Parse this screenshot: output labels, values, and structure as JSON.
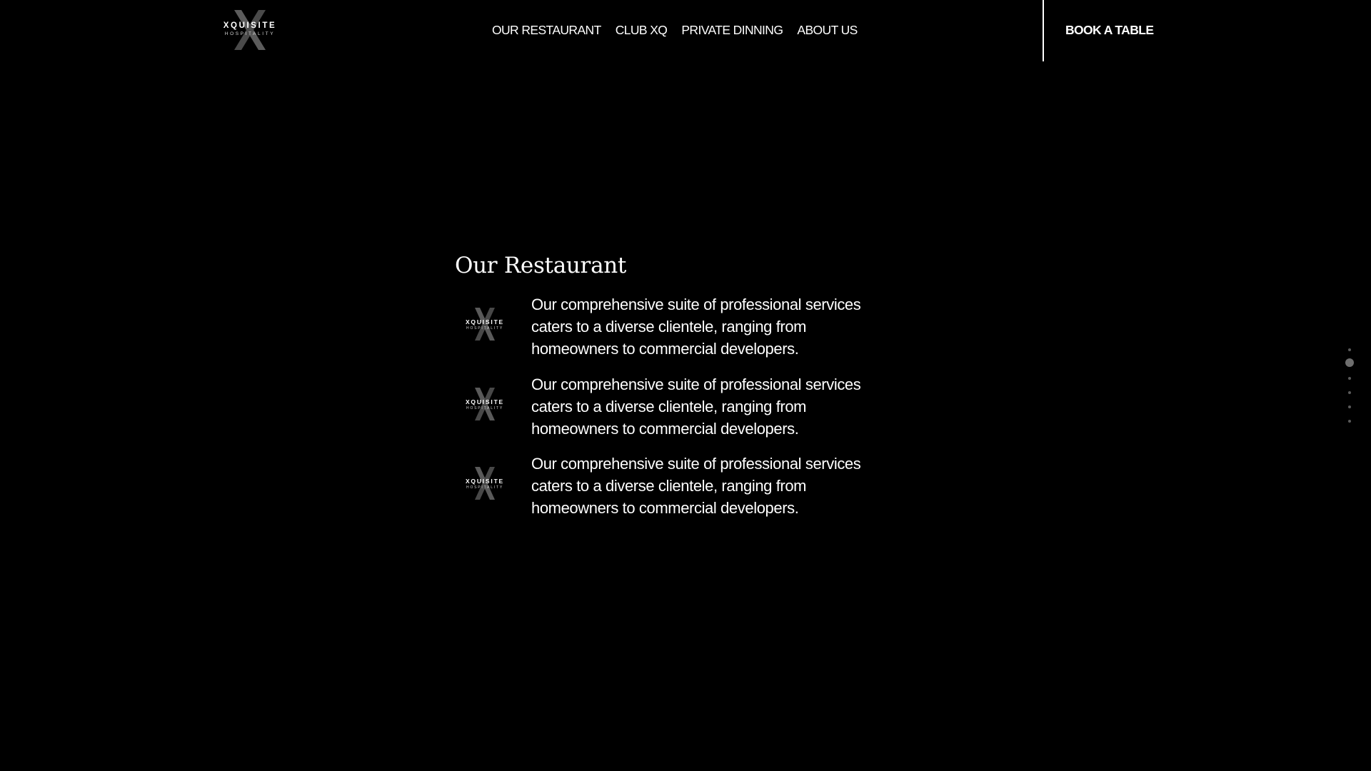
{
  "brand": {
    "wordmark": "XQUISITE",
    "tagline": "HOSPITALITY"
  },
  "nav": {
    "items": [
      {
        "label": "OUR RESTAURANT"
      },
      {
        "label": "CLUB XQ"
      },
      {
        "label": "PRIVATE DINNING"
      },
      {
        "label": "ABOUT US"
      }
    ],
    "cta_label": "BOOK A TABLE"
  },
  "section": {
    "title": "Our Restaurant",
    "features": [
      {
        "logo_wordmark": "XQUISITE",
        "logo_tagline": "HOSPITALITY",
        "text": "Our comprehensive suite of professional services caters to a diverse clientele, ranging from homeowners to commercial developers."
      },
      {
        "logo_wordmark": "XQUISITE",
        "logo_tagline": "HOSPITALITY",
        "text": "Our comprehensive suite of professional services caters to a diverse clientele, ranging from homeowners to commercial developers."
      },
      {
        "logo_wordmark": "XQUISITE",
        "logo_tagline": "HOSPITALITY",
        "text": "Our comprehensive suite of professional services caters to a diverse clientele, ranging from homeowners to commercial developers."
      }
    ]
  },
  "dot_nav": {
    "count": 6,
    "active_index": 1
  },
  "colors": {
    "background": "#000000",
    "text": "#ffffff",
    "logo_x": "#5c5c5c",
    "dot": "#5a5a5a"
  }
}
